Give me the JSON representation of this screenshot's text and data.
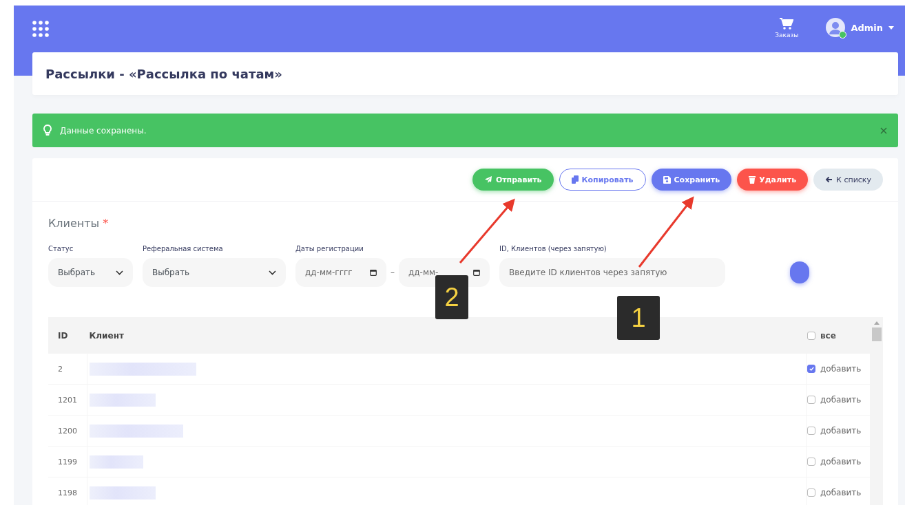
{
  "header": {
    "orders_label": "Заказы",
    "user_name": "Admin",
    "user_online": true
  },
  "page_title": "Рассылки - «Рассылка по чатам»",
  "alert": {
    "message": "Данные сохранены."
  },
  "toolbar": [
    {
      "label": "Отправить",
      "kind": "send"
    },
    {
      "label": "Копировать",
      "kind": "copy"
    },
    {
      "label": "Сохранить",
      "kind": "save"
    },
    {
      "label": "Удалить",
      "kind": "delete"
    },
    {
      "label": "К списку",
      "kind": "back"
    }
  ],
  "section": {
    "title": "Клиенты",
    "required_mark": "*"
  },
  "filters": [
    {
      "label": "Статус",
      "kind": "select",
      "value": "Выбрать"
    },
    {
      "label": "Реферальная система",
      "kind": "select",
      "value": "Выбрать"
    },
    {
      "label": "Даты регистрации",
      "kind": "daterange",
      "from_placeholder": "дд-мм-гггг",
      "range_separator": "–",
      "to_placeholder": "дд-мм-"
    },
    {
      "label": "ID, Клиентов (через запятую)",
      "kind": "text",
      "placeholder": "Введите ID клиентов через запятую"
    }
  ],
  "table": {
    "columns": [
      "ID",
      "Клиент"
    ],
    "select_all": {
      "label": "все",
      "checked": false
    },
    "rows": [
      {
        "id": "2",
        "checked": true,
        "check_label": "добавить"
      },
      {
        "id": "1201",
        "checked": false,
        "check_label": "добавить"
      },
      {
        "id": "1200",
        "checked": false,
        "check_label": "добавить"
      },
      {
        "id": "1199",
        "checked": false,
        "check_label": "добавить"
      },
      {
        "id": "1198",
        "checked": false,
        "check_label": "добавить"
      }
    ]
  },
  "annotations": [
    {
      "number": "2"
    },
    {
      "number": "1"
    }
  ]
}
